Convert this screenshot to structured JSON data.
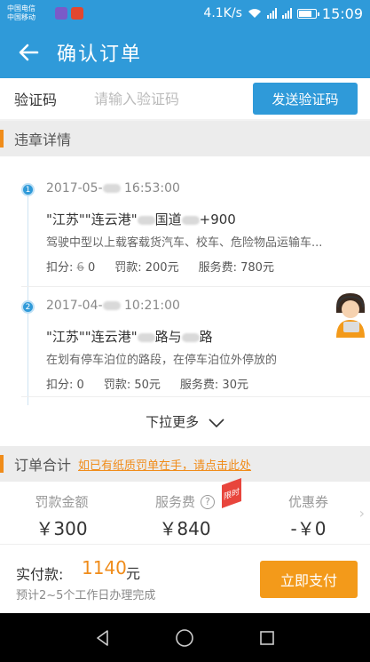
{
  "status_bar": {
    "carrier1": "中国电信",
    "carrier2": "中国移动",
    "net_speed": "4.1K/s",
    "time": "15:09"
  },
  "header": {
    "title": "确认订单"
  },
  "verify": {
    "label": "验证码",
    "placeholder": "请输入验证码",
    "send_button": "发送验证码"
  },
  "violations_section": {
    "title": "违章详情",
    "items": [
      {
        "index": "1",
        "time_prefix": "2017-05-",
        "time_suffix": "16:53:00",
        "addr_prefix": "\"江苏\"\"连云港\"",
        "addr_mid": "国道",
        "addr_suffix": "+900",
        "desc": "驾驶中型以上载客载货汽车、校车、危险物品运输车...",
        "points_label": "扣分:",
        "points_old": "6",
        "points_new": "0",
        "fine_label": "罚款:",
        "fine": "200元",
        "service_label": "服务费:",
        "service": "780元"
      },
      {
        "index": "2",
        "time_prefix": "2017-04-",
        "time_suffix": "10:21:00",
        "addr_prefix": "\"江苏\"\"连云港\"",
        "addr_mid": "路与",
        "addr_suffix": "路",
        "desc": "在划有停车泊位的路段，在停车泊位外停放的",
        "points_label": "扣分:",
        "points": "0",
        "fine_label": "罚款:",
        "fine": "50元",
        "service_label": "服务费:",
        "service": "30元"
      }
    ],
    "more": "下拉更多"
  },
  "order_section": {
    "title": "订单合计",
    "paper_link": "如已有纸质罚单在手，请点击此处"
  },
  "totals": {
    "fine_label": "罚款金额",
    "fine_value": "￥300",
    "service_label": "服务费",
    "service_value": "￥840",
    "service_badge": "限时",
    "discount_label": "优惠券",
    "discount_value": "-￥0"
  },
  "payment": {
    "label": "实付款:",
    "amount": "1140",
    "unit": "元",
    "note": "预计2~5个工作日办理完成",
    "button": "立即支付"
  },
  "colors": {
    "primary": "#2f9ad9",
    "accent": "#f08c1a",
    "pay_button": "#f39a1a"
  }
}
